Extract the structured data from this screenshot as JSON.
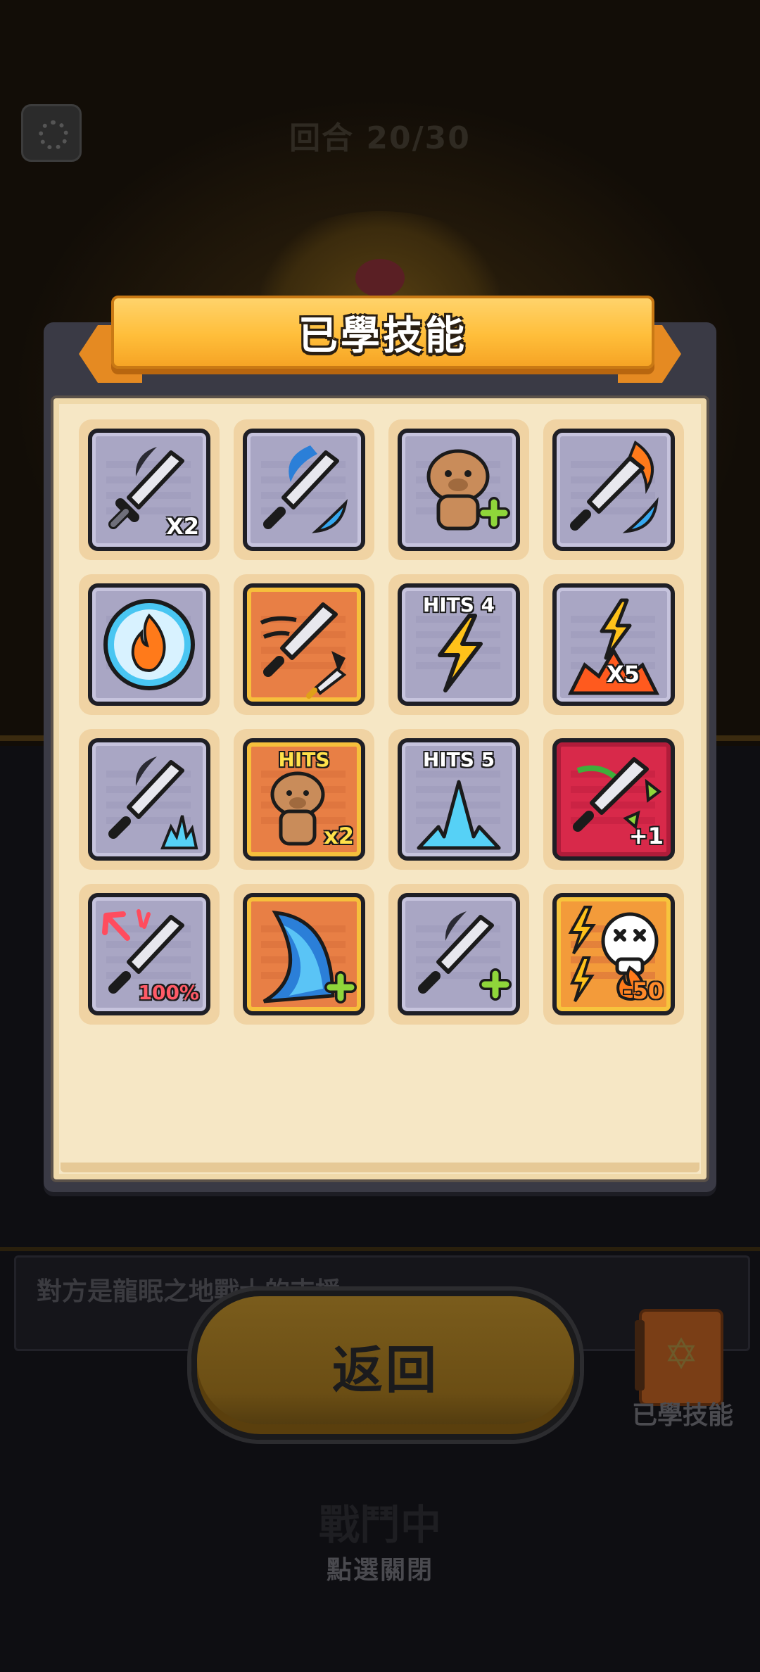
{
  "background": {
    "round_label": "回合 20/30",
    "info_text": "對方是龍眠之地戰士的支援",
    "bottom_text": "戰鬥中",
    "close_hint": "點選關閉",
    "side_button_label": "已學技能",
    "side_button_icon": "book-star-icon"
  },
  "modal": {
    "title": "已學技能",
    "return_label": "返回"
  },
  "skills": [
    {
      "icon": "sword-scythe-x2-icon",
      "badge": "X2",
      "frame": "gray"
    },
    {
      "icon": "sword-wave-icon",
      "badge": "",
      "frame": "gray"
    },
    {
      "icon": "capybara-plus-icon",
      "badge": "",
      "frame": "gray"
    },
    {
      "icon": "sword-fire-wave-icon",
      "badge": "",
      "frame": "gray"
    },
    {
      "icon": "fire-orb-icon",
      "badge": "",
      "frame": "gray"
    },
    {
      "icon": "sword-split-icon",
      "badge": "",
      "frame": "orange"
    },
    {
      "icon": "lightning-hits-4-icon",
      "badge": "HITS 4",
      "frame": "gray"
    },
    {
      "icon": "lightning-burst-x5-icon",
      "badge": "X5",
      "frame": "gray"
    },
    {
      "icon": "sword-scythe-ice-icon",
      "badge": "",
      "frame": "gray"
    },
    {
      "icon": "capybara-hits-x2-icon",
      "badge": "HITS",
      "badge2": "x2",
      "frame": "orange"
    },
    {
      "icon": "ice-burst-hits-5-icon",
      "badge": "HITS 5",
      "frame": "gray"
    },
    {
      "icon": "sword-bounce-plus-1-icon",
      "badge": "+1",
      "frame": "red"
    },
    {
      "icon": "sword-crit-100-icon",
      "badge": "100%",
      "frame": "gray"
    },
    {
      "icon": "wave-plus-icon",
      "badge": "",
      "frame": "orange"
    },
    {
      "icon": "sword-scythe-plus-icon",
      "badge": "",
      "frame": "gray"
    },
    {
      "icon": "skull-lightning-fire-icon",
      "badge": "-50",
      "frame": "gold"
    }
  ]
}
